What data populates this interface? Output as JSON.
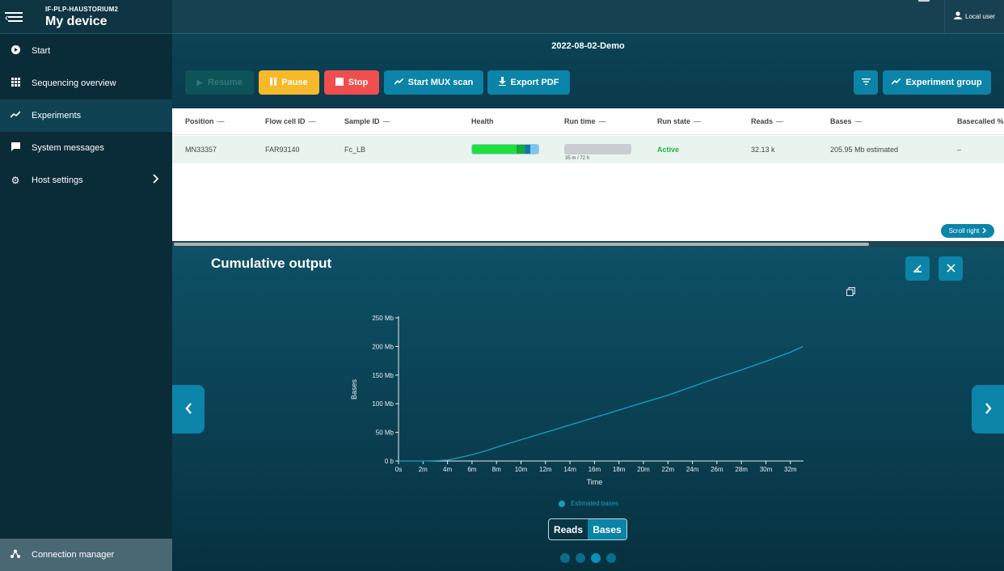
{
  "sidebar": {
    "device_subtitle": "IF-PLP-HAUSTORIUM2",
    "device_title": "My device",
    "items": [
      {
        "label": "Start",
        "icon": "play-circle-icon"
      },
      {
        "label": "Sequencing overview",
        "icon": "grid-icon"
      },
      {
        "label": "Experiments",
        "icon": "line-chart-icon"
      },
      {
        "label": "System messages",
        "icon": "message-icon"
      },
      {
        "label": "Host settings",
        "icon": "gear-icon"
      }
    ],
    "footer": {
      "label": "Connection manager",
      "icon": "network-icon"
    }
  },
  "topbar": {
    "user_label": "Local user"
  },
  "experiment": {
    "name": "2022-08-02-Demo",
    "buttons": {
      "resume": "Resume",
      "pause": "Pause",
      "stop": "Stop",
      "mux": "Start MUX scan",
      "pdf": "Export PDF",
      "group": "Experiment group"
    }
  },
  "table": {
    "headers": [
      "Position",
      "Flow cell ID",
      "Sample ID",
      "Health",
      "Run time",
      "Run state",
      "Reads",
      "Bases",
      "Basecalled %"
    ],
    "row": {
      "position": "MN33357",
      "flow_cell": "FAR93140",
      "sample": "Fc_LB",
      "runtime_label": "35 m / 72 h",
      "run_state": "Active",
      "reads": "32.13 k",
      "bases": "205.95 Mb estimated",
      "basecalled": "–"
    },
    "scroll_right": "Scroll right"
  },
  "colors": {
    "accent": "#0b84a8",
    "pause": "#f7b82a",
    "stop": "#f04e4e",
    "active": "#1fb24a",
    "health_segments": [
      "#1fe03c",
      "#15a83a",
      "#1473b0",
      "#7ec6ec"
    ]
  },
  "panel": {
    "title": "Cumulative output",
    "toggle": {
      "reads": "Reads",
      "bases": "Bases",
      "selected": "Bases"
    },
    "legend": "Estimated bases",
    "pager": {
      "count": 4,
      "active": 2
    }
  },
  "chart_data": {
    "type": "line",
    "title": "",
    "xlabel": "Time",
    "ylabel": "Bases",
    "x_ticks": [
      "0s",
      "2m",
      "4m",
      "6m",
      "8m",
      "10m",
      "12m",
      "14m",
      "16m",
      "18m",
      "20m",
      "22m",
      "24m",
      "26m",
      "28m",
      "30m",
      "32m"
    ],
    "y_ticks": [
      "0 b",
      "50 Mb",
      "100 Mb",
      "150 Mb",
      "200 Mb",
      "250 Mb"
    ],
    "xlim": [
      0,
      33
    ],
    "ylim": [
      0,
      250
    ],
    "grid": false,
    "series": [
      {
        "name": "Estimated bases",
        "x": [
          0,
          2,
          3,
          4,
          5,
          6,
          7,
          8,
          10,
          12,
          14,
          16,
          18,
          20,
          22,
          24,
          26,
          28,
          30,
          32,
          33
        ],
        "y": [
          0,
          0,
          0.5,
          1.5,
          6,
          11,
          17,
          24,
          37,
          50,
          63,
          76,
          89,
          102,
          115,
          130,
          145,
          159,
          174,
          190,
          200
        ]
      }
    ]
  }
}
